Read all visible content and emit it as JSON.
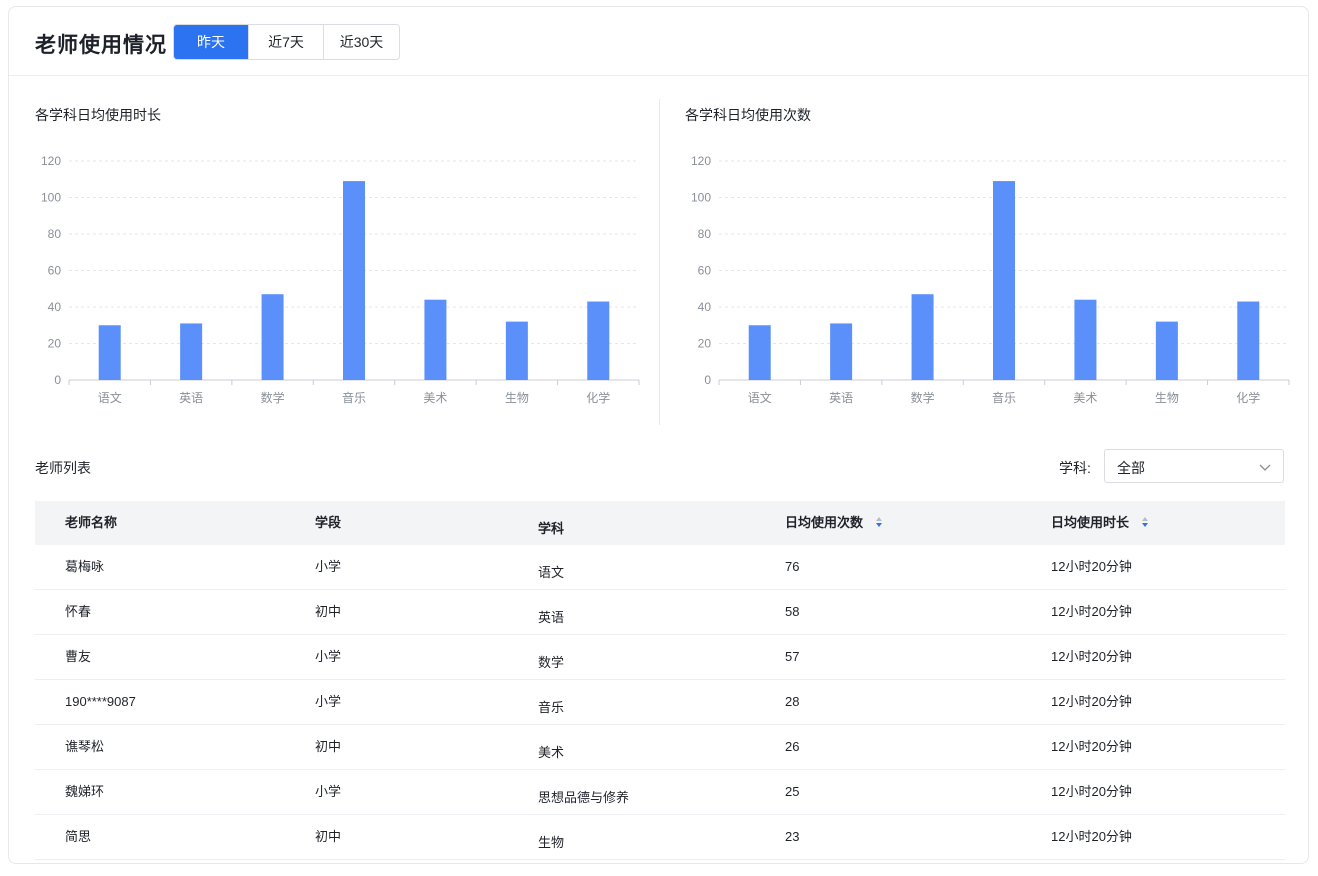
{
  "header": {
    "title": "老师使用情况",
    "range_tabs": [
      {
        "label": "昨天",
        "active": true
      },
      {
        "label": "近7天",
        "active": false
      },
      {
        "label": "近30天",
        "active": false
      }
    ]
  },
  "colors": {
    "accent": "#2b73f0",
    "bar": "#5b8ff9"
  },
  "chart_data": [
    {
      "type": "bar",
      "title": "各学科日均使用时长",
      "categories": [
        "语文",
        "英语",
        "数学",
        "音乐",
        "美术",
        "生物",
        "化学"
      ],
      "values": [
        30,
        31,
        47,
        109,
        44,
        32,
        43
      ],
      "ylim": [
        0,
        120
      ],
      "yticks": [
        0,
        20,
        40,
        60,
        80,
        100,
        120
      ],
      "grid": true
    },
    {
      "type": "bar",
      "title": "各学科日均使用次数",
      "categories": [
        "语文",
        "英语",
        "数学",
        "音乐",
        "美术",
        "生物",
        "化学"
      ],
      "values": [
        30,
        31,
        47,
        109,
        44,
        32,
        43
      ],
      "ylim": [
        0,
        120
      ],
      "yticks": [
        0,
        20,
        40,
        60,
        80,
        100,
        120
      ],
      "grid": true
    }
  ],
  "list": {
    "title": "老师列表",
    "filter_label": "学科:",
    "filter_value": "全部",
    "columns": [
      "老师名称",
      "学段",
      "学科",
      "日均使用次数",
      "日均使用时长"
    ],
    "rows": [
      [
        "葛梅咏",
        "小学",
        "语文",
        "76",
        "12小时20分钟"
      ],
      [
        "怀春",
        "初中",
        "英语",
        "58",
        "12小时20分钟"
      ],
      [
        "曹友",
        "小学",
        "数学",
        "57",
        "12小时20分钟"
      ],
      [
        "190****9087",
        "小学",
        "音乐",
        "28",
        "12小时20分钟"
      ],
      [
        "谯琴松",
        "初中",
        "美术",
        "26",
        "12小时20分钟"
      ],
      [
        "魏娣环",
        "小学",
        "思想品德与修养",
        "25",
        "12小时20分钟"
      ],
      [
        "简思",
        "初中",
        "生物",
        "23",
        "12小时20分钟"
      ]
    ]
  }
}
